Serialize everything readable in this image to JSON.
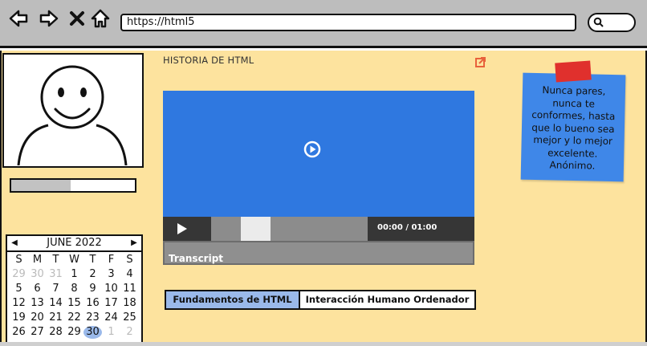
{
  "browser": {
    "url": "https://html5"
  },
  "profile": {
    "progress_fraction": 0.48
  },
  "calendar": {
    "month_label": "JUNE 2022",
    "weekdays": [
      "S",
      "M",
      "T",
      "W",
      "T",
      "F",
      "S"
    ],
    "days": [
      {
        "d": "29",
        "muted": true
      },
      {
        "d": "30",
        "muted": true
      },
      {
        "d": "31",
        "muted": true
      },
      {
        "d": "1"
      },
      {
        "d": "2"
      },
      {
        "d": "3"
      },
      {
        "d": "4"
      },
      {
        "d": "5"
      },
      {
        "d": "6"
      },
      {
        "d": "7"
      },
      {
        "d": "8"
      },
      {
        "d": "9"
      },
      {
        "d": "10"
      },
      {
        "d": "11"
      },
      {
        "d": "12"
      },
      {
        "d": "13"
      },
      {
        "d": "14"
      },
      {
        "d": "15"
      },
      {
        "d": "16"
      },
      {
        "d": "17"
      },
      {
        "d": "18"
      },
      {
        "d": "19"
      },
      {
        "d": "20"
      },
      {
        "d": "21"
      },
      {
        "d": "22"
      },
      {
        "d": "23"
      },
      {
        "d": "24"
      },
      {
        "d": "25"
      },
      {
        "d": "26"
      },
      {
        "d": "27"
      },
      {
        "d": "28"
      },
      {
        "d": "29"
      },
      {
        "d": "30",
        "today": true
      },
      {
        "d": "1",
        "muted": true
      },
      {
        "d": "2",
        "muted": true
      }
    ]
  },
  "main": {
    "title": "HISTORIA DE HTML",
    "video": {
      "time": "00:00 / 01:00",
      "played_fraction": 0.19
    },
    "transcript_label": "Transcript",
    "tabs": [
      {
        "label": "Fundamentos de HTML",
        "active": true
      },
      {
        "label": "Interacción Humano Ordenador",
        "active": false
      }
    ]
  },
  "sticky_note": {
    "text": "Nunca pares, nunca te conformes, hasta que lo bueno sea mejor y lo mejor excelente. Anónimo."
  },
  "colors": {
    "canvas": "#fde39e",
    "video": "#2f78e0",
    "sticky": "#3f87e8",
    "active_tab": "#9ab9ea",
    "link_accent": "#e8613c"
  }
}
